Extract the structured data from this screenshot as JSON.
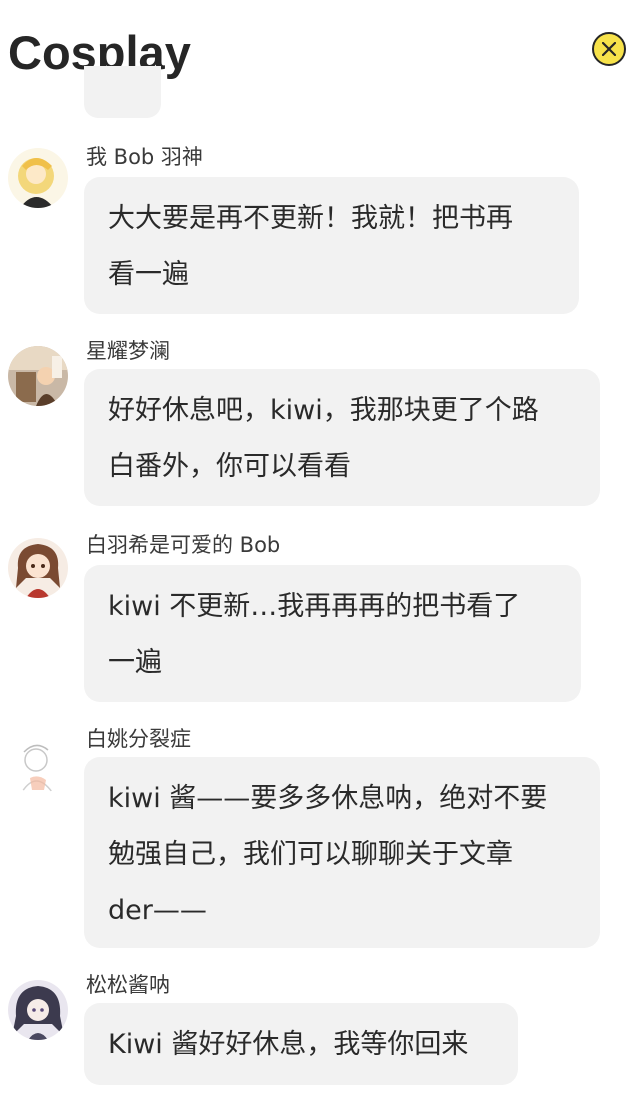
{
  "header": {
    "title": "Cosplay",
    "close_icon": "close-icon"
  },
  "colors": {
    "bubble_bg": "#f2f2f2",
    "close_button_bg": "#f7e24a",
    "text": "#262626"
  },
  "messages": [
    {
      "username": "我 Bob 羽神",
      "lines": [
        "大大要是再不更新！我就！把书再",
        "看一遍"
      ]
    },
    {
      "username": "星耀梦澜",
      "lines": [
        "好好休息吧，kiwi，我那块更了个路",
        "白番外，你可以看看"
      ]
    },
    {
      "username": "白羽希是可爱的 Bob",
      "lines": [
        "kiwi 不更新…我再再再的把书看了",
        "一遍"
      ]
    },
    {
      "username": "白姚分裂症",
      "lines": [
        "kiwi 酱——要多多休息呐，绝对不要",
        "勉强自己，我们可以聊聊关于文章",
        "der——"
      ]
    },
    {
      "username": "松松酱呐",
      "lines": [
        "Kiwi 酱好好休息，我等你回来"
      ]
    }
  ]
}
